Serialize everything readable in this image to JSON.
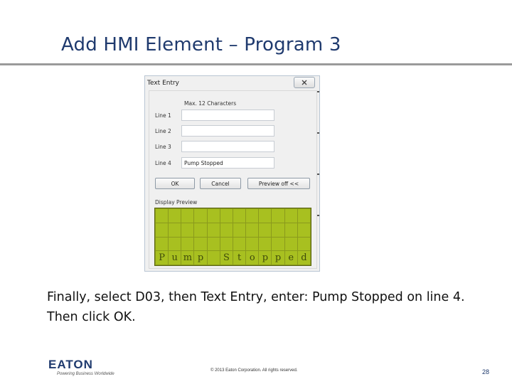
{
  "slide": {
    "title": "Add HMI Element – Program 3",
    "caption": "Finally, select D03, then Text Entry, enter: Pump Stopped on line 4. Then click OK."
  },
  "dialog": {
    "title": "Text Entry",
    "hint": "Max. 12 Characters",
    "lines": [
      {
        "label": "Line 1",
        "value": ""
      },
      {
        "label": "Line 2",
        "value": ""
      },
      {
        "label": "Line 3",
        "value": ""
      },
      {
        "label": "Line 4",
        "value": "Pump Stopped"
      }
    ],
    "buttons": {
      "ok": "OK",
      "cancel": "Cancel",
      "preview": "Preview off <<"
    },
    "preview_label": "Display Preview",
    "lcd": {
      "columns": 12,
      "rows": [
        "",
        "",
        "",
        "Pump Stopped"
      ],
      "color_bg": "#a8c020",
      "color_text": "#3e4a0a"
    }
  },
  "footer": {
    "logo": "EATON",
    "tagline": "Powering Business Worldwide",
    "copyright": "© 2013 Eaton Corporation. All rights reserved.",
    "page_number": "28"
  },
  "colors": {
    "title": "#1f3a6e",
    "rule": "#9a9a9a"
  }
}
